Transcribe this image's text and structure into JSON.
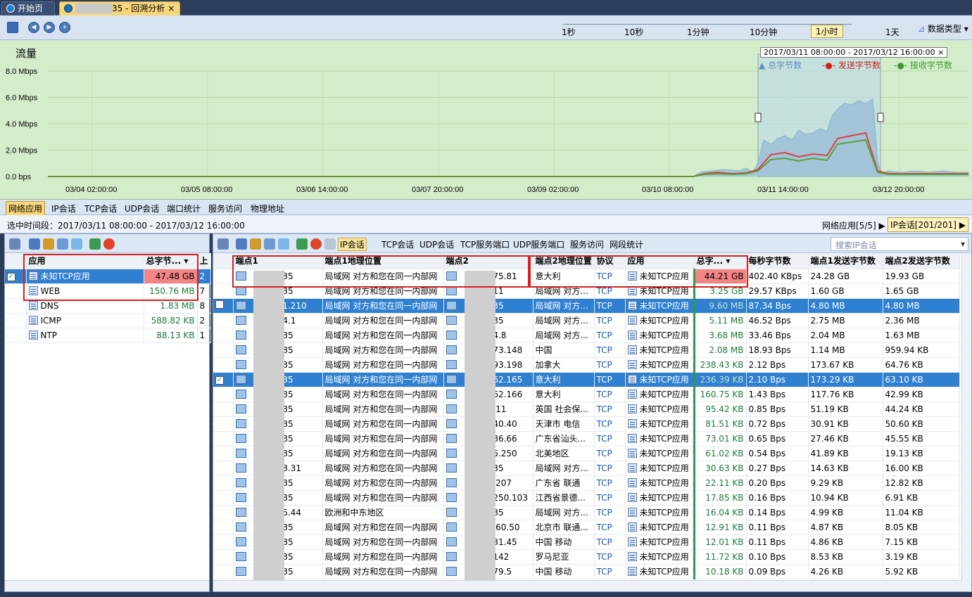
{
  "tabs": {
    "start": "开始页",
    "active_suffix": "35 - 回溯分析",
    "close": "×"
  },
  "scale": {
    "labels": [
      "1秒",
      "10秒",
      "1分钟",
      "10分钟",
      "1小时",
      "1天"
    ],
    "selected": "1小时",
    "data_type": "数据类型"
  },
  "chart": {
    "title": "流量",
    "y_ticks": [
      "8.0 Mbps",
      "6.0 Mbps",
      "4.0 Mbps",
      "2.0 Mbps",
      "0.0 bps"
    ],
    "x_ticks": [
      "03/04 02:00:00",
      "03/05 08:00:00",
      "03/06 14:00:00",
      "03/07 20:00:00",
      "03/09 02:00:00",
      "03/10 08:00:00",
      "03/11 14:00:00",
      "03/12 20:00:00"
    ],
    "selection_label": "2017/03/11 08:00:00 - 2017/03/12 16:00:00",
    "legend": [
      "总字节数",
      "发送字节数",
      "接收字节数"
    ],
    "colors": {
      "total": "#9ec0d8",
      "sent": "#d84040",
      "recv": "#5aa03a"
    }
  },
  "lower_tabs": [
    "网络应用",
    "IP会话",
    "TCP会话",
    "UDP会话",
    "端口统计",
    "服务访问",
    "物理地址"
  ],
  "range_text": "选中时间段：2017/03/11 08:00:00 - 2017/03/12 16:00:00",
  "crumbs": {
    "apps": "网络应用[5/5]",
    "ip": "IP会话[201/201]"
  },
  "left": {
    "headers": [
      "应用",
      "总字节...",
      "上"
    ],
    "rows": [
      {
        "name": "未知TCP应用",
        "bytes": "47.48 GB",
        "extra": "2"
      },
      {
        "name": "WEB",
        "bytes": "150.76 MB",
        "extra": "7"
      },
      {
        "name": "DNS",
        "bytes": "1.83 MB",
        "extra": "8"
      },
      {
        "name": "ICMP",
        "bytes": "588.82 KB",
        "extra": "2"
      },
      {
        "name": "NTP",
        "bytes": "88.13 KB",
        "extra": "1"
      }
    ]
  },
  "right": {
    "toolbar": [
      "IP会话",
      "TCP会话",
      "UDP会话",
      "TCP服务端口",
      "UDP服务端口",
      "服务访问",
      "网段统计"
    ],
    "search_placeholder": "搜索IP会话",
    "headers": [
      "端点1",
      "端点1地理位置",
      "端点2",
      "端点2地理位置",
      "协议",
      "应用",
      "总字...",
      "每秒字节数",
      "端点1发送字节数",
      "端点2发送字节数"
    ],
    "rows": [
      [
        "35",
        "局域网 对方和您在同一内部网",
        "75.81",
        "意大利",
        "TCP",
        "未知TCP应用",
        "44.21 GB",
        "402.40 KBps",
        "24.28 GB",
        "19.93 GB"
      ],
      [
        "35",
        "局域网 对方和您在同一内部网",
        "11",
        "局域网 对方...",
        "TCP",
        "未知TCP应用",
        "3.25 GB",
        "29.57 KBps",
        "1.60 GB",
        "1.65 GB"
      ],
      [
        "1.210",
        "局域网 对方和您在同一内部网",
        "35",
        "局域网 对方...",
        "TCP",
        "未知TCP应用",
        "9.60 MB",
        "87.34 Bps",
        "4.80 MB",
        "4.80 MB"
      ],
      [
        "4.1",
        "局域网 对方和您在同一内部网",
        "35",
        "局域网 对方...",
        "TCP",
        "未知TCP应用",
        "5.11 MB",
        "46.52 Bps",
        "2.75 MB",
        "2.36 MB"
      ],
      [
        "35",
        "局域网 对方和您在同一内部网",
        "4.8",
        "局域网 对方...",
        "TCP",
        "未知TCP应用",
        "3.68 MB",
        "33.46 Bps",
        "2.04 MB",
        "1.63 MB"
      ],
      [
        "35",
        "局域网 对方和您在同一内部网",
        "73.148",
        "中国",
        "TCP",
        "未知TCP应用",
        "2.08 MB",
        "18.93 Bps",
        "1.14 MB",
        "959.94 KB"
      ],
      [
        "35",
        "局域网 对方和您在同一内部网",
        "93.198",
        "加拿大",
        "TCP",
        "未知TCP应用",
        "238.43 KB",
        "2.12 Bps",
        "173.67 KB",
        "64.76 KB"
      ],
      [
        "35",
        "局域网 对方和您在同一内部网",
        "62.165",
        "意大利",
        "TCP",
        "未知TCP应用",
        "236.39 KB",
        "2.10 Bps",
        "173.29 KB",
        "63.10 KB"
      ],
      [
        "35",
        "局域网 对方和您在同一内部网",
        "62.166",
        "意大利",
        "TCP",
        "未知TCP应用",
        "160.75 KB",
        "1.43 Bps",
        "117.76 KB",
        "42.99 KB"
      ],
      [
        "35",
        "局域网 对方和您在同一内部网",
        ".11",
        "英国 社会保...",
        "TCP",
        "未知TCP应用",
        "95.42 KB",
        "0.85 Bps",
        "51.19 KB",
        "44.24 KB"
      ],
      [
        "35",
        "局域网 对方和您在同一内部网",
        "40.40",
        "天津市 电信",
        "TCP",
        "未知TCP应用",
        "81.51 KB",
        "0.72 Bps",
        "30.91 KB",
        "50.60 KB"
      ],
      [
        "35",
        "局域网 对方和您在同一内部网",
        "36.66",
        "广东省汕头...",
        "TCP",
        "未知TCP应用",
        "73.01 KB",
        "0.65 Bps",
        "27.46 KB",
        "45.55 KB"
      ],
      [
        "35",
        "局域网 对方和您在同一内部网",
        "5.250",
        "北美地区",
        "TCP",
        "未知TCP应用",
        "61.02 KB",
        "0.54 Bps",
        "41.89 KB",
        "19.13 KB"
      ],
      [
        "3.31",
        "局域网 对方和您在同一内部网",
        "35",
        "局域网 对方...",
        "TCP",
        "未知TCP应用",
        "30.63 KB",
        "0.27 Bps",
        "14.63 KB",
        "16.00 KB"
      ],
      [
        "35",
        "局域网 对方和您在同一内部网",
        ".207",
        "广东省 联通",
        "TCP",
        "未知TCP应用",
        "22.11 KB",
        "0.20 Bps",
        "9.29 KB",
        "12.82 KB"
      ],
      [
        "35",
        "局域网 对方和您在同一内部网",
        "250.103",
        "江西省景德...",
        "TCP",
        "未知TCP应用",
        "17.85 KB",
        "0.16 Bps",
        "10.94 KB",
        "6.91 KB"
      ],
      [
        "5.44",
        "欧洲和中东地区",
        "35",
        "局域网 对方...",
        "TCP",
        "未知TCP应用",
        "16.04 KB",
        "0.14 Bps",
        "4.99 KB",
        "11.04 KB"
      ],
      [
        "35",
        "局域网 对方和您在同一内部网",
        ".60.50",
        "北京市 联通...",
        "TCP",
        "未知TCP应用",
        "12.91 KB",
        "0.11 Bps",
        "4.87 KB",
        "8.05 KB"
      ],
      [
        "35",
        "局域网 对方和您在同一内部网",
        "31.45",
        "中国 移动",
        "TCP",
        "未知TCP应用",
        "12.01 KB",
        "0.11 Bps",
        "4.86 KB",
        "7.15 KB"
      ],
      [
        "35",
        "局域网 对方和您在同一内部网",
        "142",
        "罗马尼亚",
        "TCP",
        "未知TCP应用",
        "11.72 KB",
        "0.10 Bps",
        "8.53 KB",
        "3.19 KB"
      ],
      [
        "35",
        "局域网 对方和您在同一内部网",
        "79.5",
        "中国 移动",
        "TCP",
        "未知TCP应用",
        "10.18 KB",
        "0.09 Bps",
        "4.26 KB",
        "5.92 KB"
      ]
    ]
  }
}
